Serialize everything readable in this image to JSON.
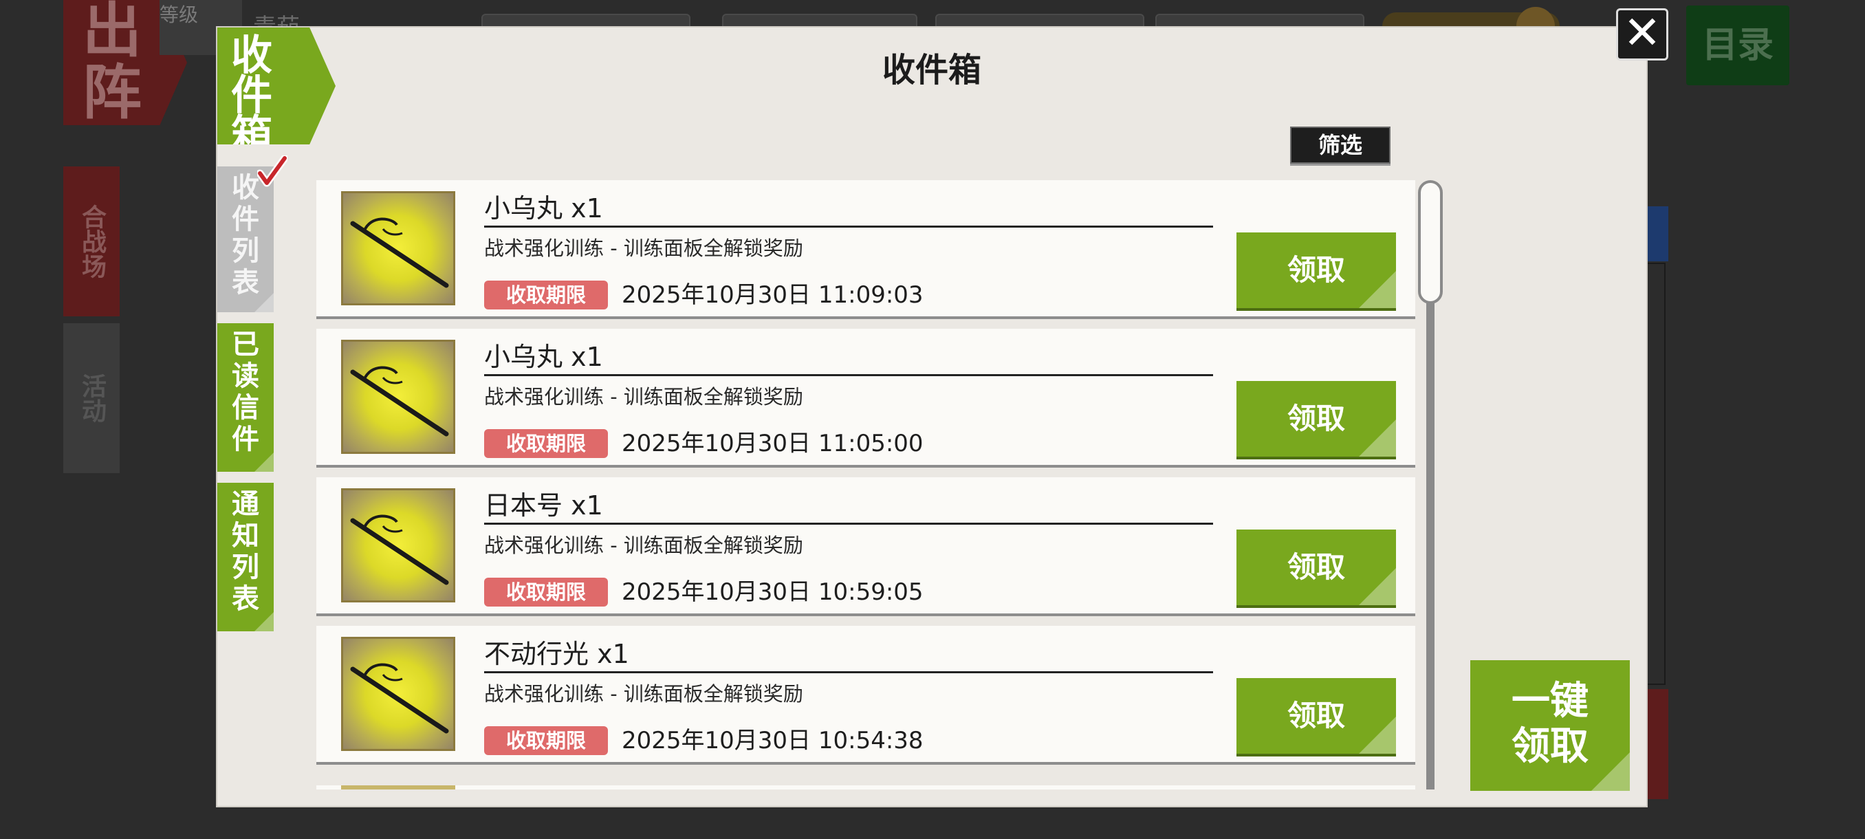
{
  "background": {
    "sortie_label": "出阵",
    "level_label": "等级",
    "player_name": "青茄",
    "menu_label": "目录",
    "tab_arena": "合战场",
    "tab_event": "活动"
  },
  "dialog": {
    "title": "收件箱",
    "badge": [
      "收",
      "件",
      "箱"
    ],
    "filter_label": "筛选",
    "close_glyph": "✕",
    "tabs": [
      {
        "chars": [
          "收",
          "件",
          "列",
          "表"
        ],
        "active": true
      },
      {
        "chars": [
          "已",
          "读",
          "信",
          "件"
        ],
        "active": false
      },
      {
        "chars": [
          "通",
          "知",
          "列",
          "表"
        ],
        "active": false
      }
    ],
    "deadline_label": "收取期限",
    "claim_label": "领取",
    "claim_all": [
      "一键",
      "领取"
    ],
    "mails": [
      {
        "item": "小乌丸 x1",
        "source": "战术强化训练 - 训练面板全解锁奖励",
        "deadline": "2025年10月30日 11:09:03",
        "icon": "katana-icon"
      },
      {
        "item": "小乌丸 x1",
        "source": "战术强化训练 - 训练面板全解锁奖励",
        "deadline": "2025年10月30日 11:05:00",
        "icon": "katana-icon"
      },
      {
        "item": "日本号 x1",
        "source": "战术强化训练 - 训练面板全解锁奖励",
        "deadline": "2025年10月30日 10:59:05",
        "icon": "katana-icon"
      },
      {
        "item": "不动行光 x1",
        "source": "战术强化训练 - 训练面板全解锁奖励",
        "deadline": "2025年10月30日 10:54:38",
        "icon": "katana-icon"
      }
    ]
  },
  "colors": {
    "accent_green": "#79a81e",
    "deadline_red": "#df6a6a",
    "panel_bg": "#ebe8e3"
  }
}
